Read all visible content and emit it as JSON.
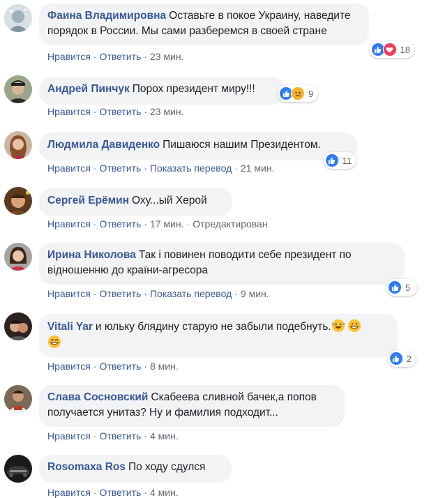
{
  "actions": {
    "like": "Нравится",
    "reply": "Ответить",
    "translate": "Показать перевод",
    "edited": "Отредактирован",
    "sep": "·"
  },
  "colors": {
    "author": "#385898",
    "bubble": "#f2f3f5",
    "like": "#2e7cf6",
    "love": "#f33e58"
  },
  "comments": [
    {
      "author": "Фаина Владимировна",
      "text_1": "Оставьте в покое Украину, наведите",
      "text_2": "порядок в России. Мы сами разберемся в своей стране",
      "time": "23 мин.",
      "reaction_count": "18",
      "reaction_icons": [
        "like-icon",
        "love-icon"
      ]
    },
    {
      "author": "Андрей Пинчук",
      "text": "Порох президент миру!!!",
      "time": "23 мин.",
      "reaction_count": "9",
      "reaction_icons": [
        "like-icon",
        "sad-icon"
      ]
    },
    {
      "author": "Людмила Давиденко",
      "text": "Пишаюся нашим Президентом.",
      "time": "21 мин.",
      "reaction_count": "11",
      "reaction_icons": [
        "like-icon"
      ]
    },
    {
      "author": "Сергей Ерёмин",
      "text": "Оху...ый Херой",
      "time": "17 мин.",
      "reaction_icons": []
    },
    {
      "author": "Ирина Николова",
      "text_1": "Так і повинен поводити себе президент по",
      "text_2": "відношенню до країни-агресора",
      "time": "9 мин.",
      "reaction_count": "5",
      "reaction_icons": [
        "like-icon"
      ]
    },
    {
      "author": "Vitali Yar",
      "text": "и юльку блядину старую не забыли подебнуть.",
      "time": "8 мин.",
      "reaction_count": "2",
      "reaction_icons": [
        "like-icon"
      ],
      "emojis": [
        "rolling-laughing-emoji",
        "grinning-emoji",
        "beaming-emoji"
      ]
    },
    {
      "author": "Слава Сосновский",
      "text_1": "Скабеева сливной бачек,а попов",
      "text_2": "получается унитаз? Ну и фамилия подходит...",
      "time": "4 мин.",
      "reaction_icons": []
    },
    {
      "author": "Rosomaxa Ros",
      "text": "По ходу сдулся",
      "time": "4 мин.",
      "reaction_icons": []
    }
  ]
}
